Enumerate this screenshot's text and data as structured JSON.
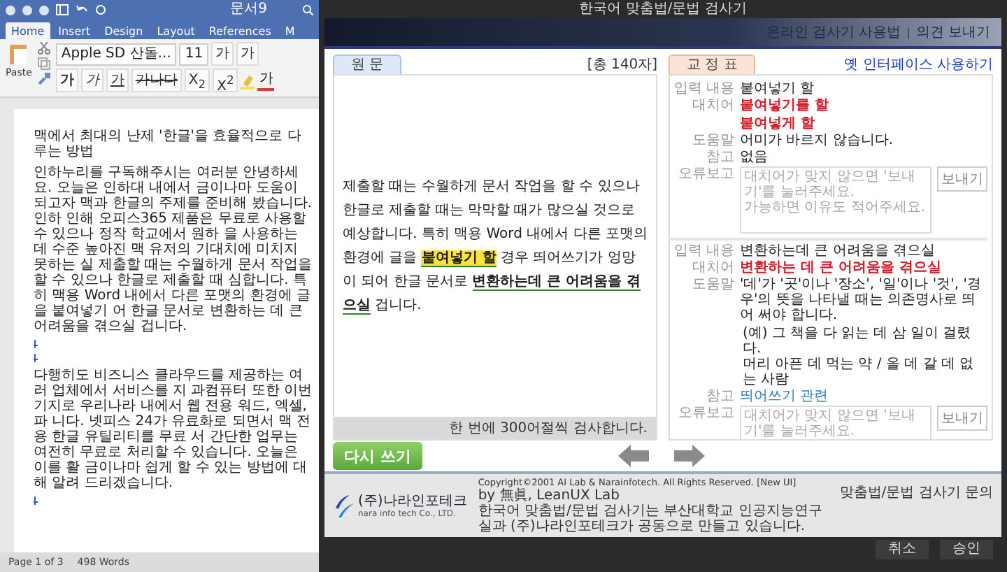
{
  "word": {
    "title": "문서9",
    "tabs": [
      {
        "label": "Home",
        "selected": true
      },
      {
        "label": "Insert",
        "selected": false
      },
      {
        "label": "Design",
        "selected": false
      },
      {
        "label": "Layout",
        "selected": false
      },
      {
        "label": "References",
        "selected": false
      },
      {
        "label": "M",
        "selected": false
      }
    ],
    "ribbon": {
      "paste": "Paste",
      "font": "Apple SD 산돌...",
      "size": "11",
      "grow": "가",
      "shrink": "가",
      "format": [
        {
          "kind": "bold",
          "text": "가"
        },
        {
          "kind": "italic",
          "text": "가"
        },
        {
          "kind": "underline",
          "text": "가"
        },
        {
          "kind": "strike",
          "text": "가나다"
        },
        {
          "kind": "script",
          "text": "X$_{2}$"
        },
        {
          "kind": "script",
          "text": "X$^{2}$"
        }
      ],
      "font_color": "가"
    },
    "document": [
      {
        "kind": "text",
        "text": "맥에서 최대의 난제 '한글'을 효율적으로 다루는 방법"
      },
      {
        "kind": "text",
        "text": "인하누리를 구독해주시는 여러분 안녕하세요. 오늘은 인하대 내에서 금이나마 도움이 되고자 맥과 한글의 주제를 준비해 봤습니다. 인하 인해 오피스365 제품은 무료로 사용할 수 있으나 정작 학교에서 원하 을 사용하는 데 수준 높아진 맥 유저의 기대치에 미치지 못하는 실 제출할 때는 수월하게 문서 작업을 할 수 있으나 한글로 제출할 때 심합니다. 특히 맥용 Word 내에서 다른 포맷의 환경에 글을 붙여넣기 어 한글 문서로 변환하는 데 큰 어려움을 겪으실 겁니다."
      },
      {
        "kind": "empty"
      },
      {
        "kind": "empty"
      },
      {
        "kind": "text",
        "text": "다행히도 비즈니스 클라우드를 제공하는 여러 업체에서 서비스를 지 과컴퓨터 또한 이번기지로 우리나라 내에서 웹 전용 워드, 엑셀, 파 니다. 넷피스 24가 유료화로 되면서 맥 전용 한글 유틸리티를 무료 서 간단한 업무는 여전히 무료로 처리할 수 있습니다. 오늘은 이를 활 금이나마 쉽게 할 수 있는 방법에 대해 알려 드리겠습니다."
      },
      {
        "kind": "empty"
      }
    ],
    "status": {
      "page": "Page 1 of 3",
      "words": "498 Words"
    }
  },
  "checker": {
    "title": "한국어 맞춤법/문법 검사기",
    "links": [
      "온라인 검사기 사용법",
      "의견 보내기"
    ],
    "link_separator": "|",
    "original": {
      "tab": "원 문",
      "count": "[총 140자]",
      "segments": [
        {
          "kind": "plain",
          "text": "제출할 때는 수월하게 문서 작업을 할 수 있으나 한글로 제출할 때는 막막할 때가 많으실 것으로 예상합니다. 특히 맥용 Word 내에서 다른 포맷의 환경에 글을 "
        },
        {
          "kind": "highlight",
          "text": "붙여넣기 할"
        },
        {
          "kind": "plain",
          "text": " 경우 띄어쓰기가 엉망이 되어 한글 문서로 "
        },
        {
          "kind": "underline",
          "text": "변환하는데 큰 어려움을 겪으실"
        },
        {
          "kind": "plain",
          "text": " 겁니다."
        }
      ],
      "note": "한 번에 300어절씩 검사합니다."
    },
    "corrections": {
      "tab": "교 정 표",
      "old_ui_link": "옛 인터페이스 사용하기",
      "items": [
        {
          "labels": {
            "input": "입력 내용",
            "replacement": "대치어",
            "help": "도움말",
            "reference": "참고",
            "report": "오류보고"
          },
          "input": "붙여넣기 할",
          "replacements": [
            "붙여넣기를 할",
            "붙여넣게 할"
          ],
          "help": "어미가 바르지 않습니다.",
          "reference": "없음",
          "reference_link": false,
          "report_placeholder": "대치어가 맞지 않으면 '보내기'를 눌러주세요.\n가능하면 이유도 적어주세요.",
          "send": "보내기"
        },
        {
          "labels": {
            "input": "입력 내용",
            "replacement": "대치어",
            "help": "도움말",
            "reference": "참고",
            "report": "오류보고"
          },
          "input": "변환하는데 큰 어려움을 겪으실",
          "replacements": [
            "변환하는 데 큰 어려움을 겪으실"
          ],
          "help": "'데'가 '곳'이나 '장소', '일'이나 '것', '경우'의 뜻을 나타낼 때는 의존명사로 띄어 써야 합니다.",
          "examples": [
            "(예) 그 책을 다 읽는 데 삼 일이 걸렸다.",
            "머리 아픈 데 먹는 약 / 올 데 갈 데 없는 사람"
          ],
          "reference": "띄어쓰기 관련",
          "reference_link": true,
          "report_placeholder": "대치어가 맞지 않으면 '보내기'를 눌러주세요.",
          "send": "보내기"
        }
      ]
    },
    "rewrite_button": "다시 쓰기",
    "footer": {
      "company": "(주)나라인포테크",
      "company_en": "nara info tech Co., LTD.",
      "copyright": "Copyright©2001 AI Lab & Narainfotech. All Rights Reserved. [New UI]",
      "credit": "by 無眞, LeanUX Lab",
      "about": "한국어 맞춤법/문법 검사기는 부산대학교 인공지능연구실과 (주)나라인포테크가 공동으로 만들고 있습니다.",
      "contact": "맞춤법/문법 검사기 문의"
    },
    "buttons": [
      "취소",
      "승인"
    ]
  }
}
